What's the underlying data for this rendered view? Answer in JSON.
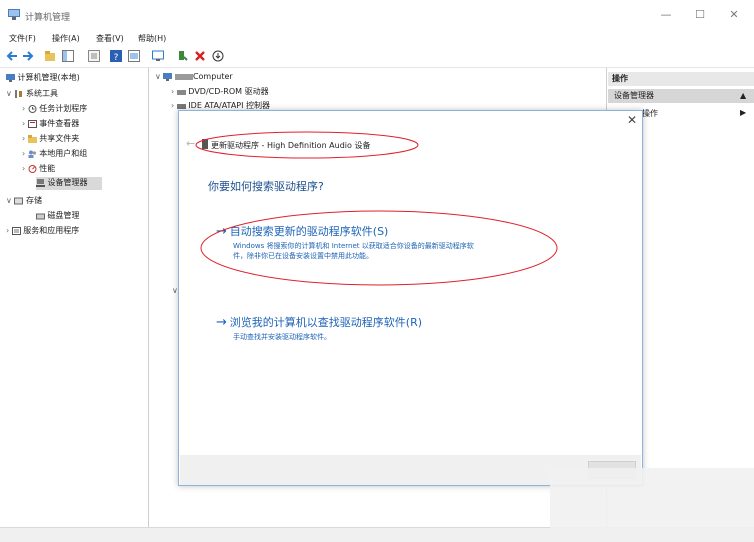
{
  "window": {
    "title": "计算机管理",
    "minimize": "—",
    "maximize": "☐",
    "close": "✕"
  },
  "menubar": [
    "文件(F)",
    "操作(A)",
    "查看(V)",
    "帮助(H)"
  ],
  "left_tree": {
    "root": "计算机管理(本地)",
    "system_tools": "系统工具",
    "system_children": [
      "任务计划程序",
      "事件查看器",
      "共享文件夹",
      "本地用户和组",
      "性能",
      "设备管理器"
    ],
    "storage": "存储",
    "storage_children": [
      "磁盘管理"
    ],
    "services": "服务和应用程序"
  },
  "middle": {
    "computer": "Computer",
    "dvd": "DVD/CD-ROM 驱动器",
    "ide": "IDE ATA/ATAPI 控制器"
  },
  "right_pane": {
    "header": "操作",
    "selected": "设备管理器",
    "more": "操作"
  },
  "dialog": {
    "close": "✕",
    "back": "←",
    "header": "更新驱动程序 - High Definition Audio 设备",
    "question": "你要如何搜索驱动程序?",
    "option1_title": "自动搜索更新的驱动程序软件(S)",
    "option1_desc_line1": "Windows 将搜索你的计算机和 Internet 以获取适合你设备的最新驱动程序软",
    "option1_desc_line2": "件，除非你已在设备安装设置中禁用此功能。",
    "option2_title": "浏览我的计算机以查找驱动程序软件(R)",
    "option2_desc": "手动查找并安装驱动程序软件。",
    "arrow": "→"
  },
  "colors": {
    "link": "#1c63b7",
    "annotation": "#e0202a",
    "dialog_border": "#8fb4dc"
  }
}
